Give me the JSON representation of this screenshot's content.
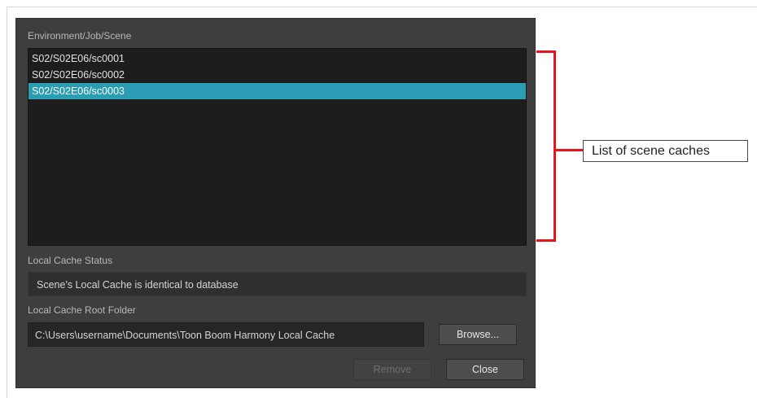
{
  "dialog": {
    "environment_label": "Environment/Job/Scene",
    "scenes": [
      {
        "path": "S02/S02E06/sc0001",
        "selected": false
      },
      {
        "path": "S02/S02E06/sc0002",
        "selected": false
      },
      {
        "path": "S02/S02E06/sc0003",
        "selected": true
      }
    ],
    "cache_status_label": "Local Cache Status",
    "cache_status_value": "Scene's Local Cache is identical to database",
    "root_folder_label": "Local Cache Root Folder",
    "root_folder_value": "C:\\Users\\username\\Documents\\Toon Boom Harmony Local Cache",
    "browse_label": "Browse...",
    "remove_label": "Remove",
    "close_label": "Close"
  },
  "annotation": {
    "callout_text": "List of scene caches"
  },
  "colors": {
    "selection": "#2a9db3",
    "annotation_red": "#e8141b",
    "dialog_background": "#3e3e3e"
  }
}
